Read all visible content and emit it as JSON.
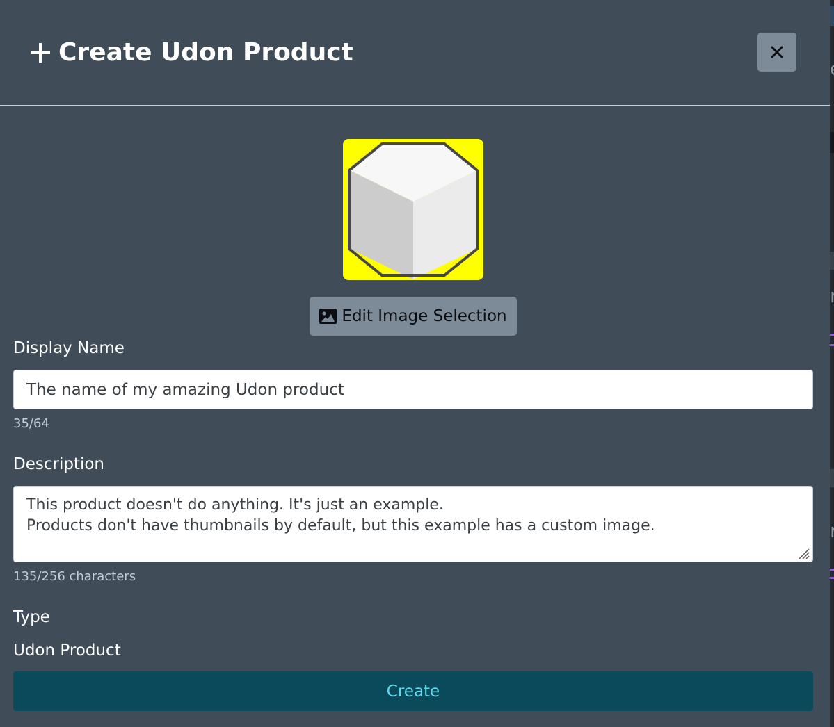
{
  "dialog": {
    "title": "Create Udon Product",
    "header_icon": "plus-icon",
    "close_icon": "close-icon"
  },
  "preview": {
    "background_color": "#ffff00",
    "icon": "cube-icon"
  },
  "edit_image_button": {
    "label": "Edit Image Selection",
    "icon": "image-icon"
  },
  "display_name": {
    "label": "Display Name",
    "value": "The name of my amazing Udon product",
    "counter": "35/64"
  },
  "description": {
    "label": "Description",
    "value": "This product doesn't do anything. It's just an example.\nProducts don't have thumbnails by default, but this example has a custom image.",
    "counter": "135/256 characters"
  },
  "type": {
    "label": "Type",
    "value": "Udon Product"
  },
  "create_button": {
    "label": "Create"
  },
  "colors": {
    "modal_background": "#404c58",
    "secondary_button": "#7d8b99",
    "primary_button": "#0b4a5a",
    "primary_button_text": "#5fd8ec"
  }
}
